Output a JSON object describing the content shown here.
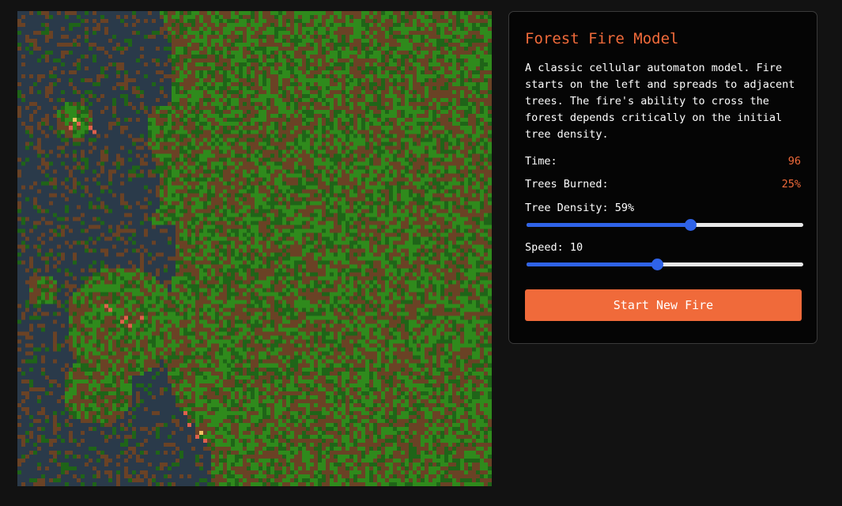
{
  "simulation": {
    "grid_cols": 120,
    "grid_rows": 120,
    "colors": {
      "empty": "#2a3a4a",
      "tree_light": "#2f8a1c",
      "tree_dark": "#1f6418",
      "burnt": "#6a4225",
      "fire": "#e0604c",
      "ember": "#f0c060"
    }
  },
  "panel": {
    "title": "Forest Fire Model",
    "description": "A classic cellular automaton model. Fire starts on the left and spreads to adjacent trees. The fire's ability to cross the forest depends critically on the initial tree density.",
    "stats": {
      "time_label": "Time:",
      "time_value": "96",
      "burned_label": "Trees Burned:",
      "burned_value": "25%"
    },
    "density": {
      "label": "Tree Density: 59%",
      "value": 0.59
    },
    "speed": {
      "label": "Speed: 10",
      "value": 0.47
    },
    "start_button": "Start New Fire"
  },
  "theme": {
    "accent": "#f06a3a",
    "slider_blue": "#2f63e8",
    "background": "#121212",
    "panel_bg": "#050505"
  }
}
